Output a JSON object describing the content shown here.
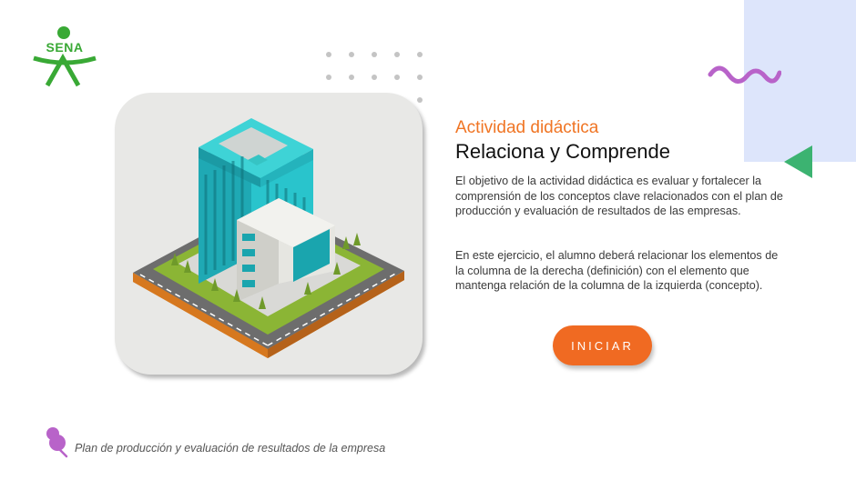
{
  "brand": {
    "logo_text": "SENA",
    "logo_color": "#39a935"
  },
  "activity": {
    "kicker": "Actividad didáctica",
    "title": "Relaciona y Comprende",
    "paragraph_1": "El objetivo de la actividad didáctica es evaluar y fortalecer la comprensión de los conceptos clave relacionados con el plan de producción y evaluación de resultados de las empresas.",
    "paragraph_2": "En este ejercicio, el alumno deberá relacionar los elementos de la columna de la derecha (definición) con el elemento que mantenga relación de la columna de la izquierda (concepto).",
    "start_label": "INICIAR"
  },
  "footer": {
    "text": "Plan de producción y evaluación de resultados de la empresa"
  },
  "colors": {
    "accent_orange": "#f06a22",
    "kicker_orange": "#f07524",
    "panel_blue": "#dde5fb",
    "squiggle_purple": "#b863c9",
    "triangle_green": "#3cb371"
  },
  "icons": {
    "logo": "sena-logo",
    "decor": [
      "dot-grid-icon",
      "squiggle-icon",
      "triangle-icon"
    ],
    "illustration": "isometric-building-illustration",
    "footer": "pushpin-icon"
  }
}
